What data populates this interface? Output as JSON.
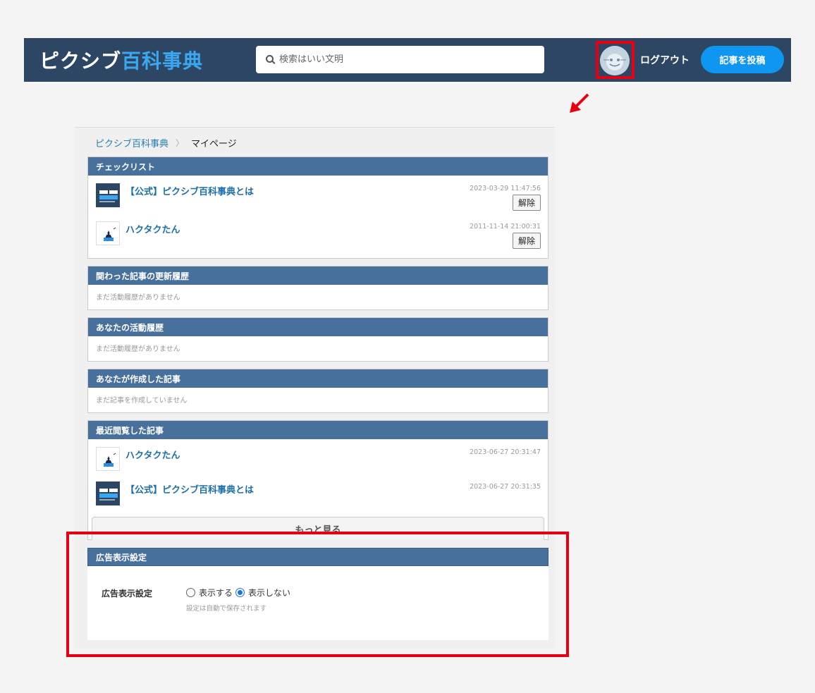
{
  "header": {
    "logo_part1": "ピクシブ",
    "logo_part2": "百科事典",
    "search_placeholder": "検索はいい文明",
    "logout_label": "ログアウト",
    "post_label": "記事を投稿"
  },
  "breadcrumb": {
    "home": "ピクシブ百科事典",
    "separator": "〉",
    "current": "マイページ"
  },
  "checklist": {
    "title": "チェックリスト",
    "unlink_label": "解除",
    "items": [
      {
        "title": "【公式】ピクシブ百科事典とは",
        "date": "2023-03-29 11:47:56",
        "icon": "pixiv-encyclopedia-logo-icon"
      },
      {
        "title": "ハクタクたん",
        "date": "2011-11-14 21:00:31",
        "icon": "hakutaku-character-icon"
      }
    ]
  },
  "related_history": {
    "title": "関わった記事の更新履歴",
    "empty": "まだ活動履歴がありません"
  },
  "activity_history": {
    "title": "あなたの活動履歴",
    "empty": "まだ活動履歴がありません"
  },
  "created_articles": {
    "title": "あなたが作成した記事",
    "empty": "まだ記事を作成していません"
  },
  "recent": {
    "title": "最近閲覧した記事",
    "items": [
      {
        "title": "ハクタクたん",
        "date": "2023-06-27 20:31:47",
        "icon": "hakutaku-character-icon"
      },
      {
        "title": "【公式】ピクシブ百科事典とは",
        "date": "2023-06-27 20:31:35",
        "icon": "pixiv-encyclopedia-logo-icon"
      }
    ],
    "more_label": "もっと見る"
  },
  "ad_settings": {
    "title": "広告表示設定",
    "label": "広告表示設定",
    "option_show": "表示する",
    "option_hide": "表示しない",
    "selected": "表示しない",
    "note": "設定は自動で保存されます"
  },
  "colors": {
    "header_bg": "#2c4664",
    "section_head_bg": "#48709d",
    "accent_blue": "#0f96f0",
    "highlight_red": "#e60012",
    "link_blue": "#1b6fa8"
  }
}
